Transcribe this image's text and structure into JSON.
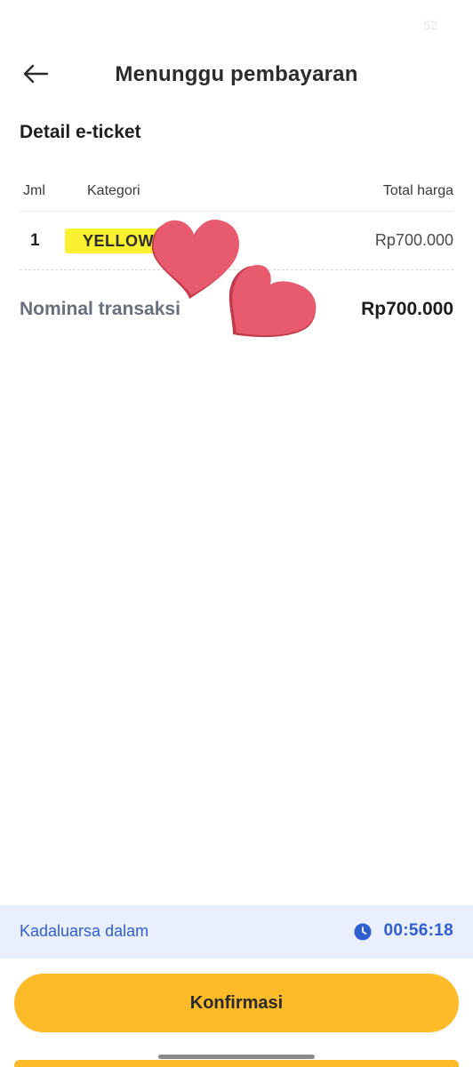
{
  "status_bar": {
    "number": "52"
  },
  "header": {
    "title": "Menunggu pembayaran"
  },
  "section": {
    "title": "Detail e-ticket"
  },
  "table": {
    "headers": {
      "qty": "Jml",
      "category": "Kategori",
      "total": "Total harga"
    },
    "rows": [
      {
        "qty": "1",
        "category": "YELLOW",
        "price": "Rp700.000",
        "badge_color": "#f9f02f"
      }
    ]
  },
  "summary": {
    "label": "Nominal transaksi",
    "value": "Rp700.000"
  },
  "overlay": {
    "icons": [
      "heart-sticker",
      "heart-sticker"
    ],
    "color": "#e85a6e"
  },
  "expiry": {
    "label": "Kadaluarsa dalam",
    "time": "00:56:18",
    "icon": "clock-icon"
  },
  "footer": {
    "confirm_label": "Konfirmasi"
  },
  "colors": {
    "accent": "#fdbb2a",
    "info_bg": "#e9effd",
    "info_text": "#2f5ed1"
  }
}
